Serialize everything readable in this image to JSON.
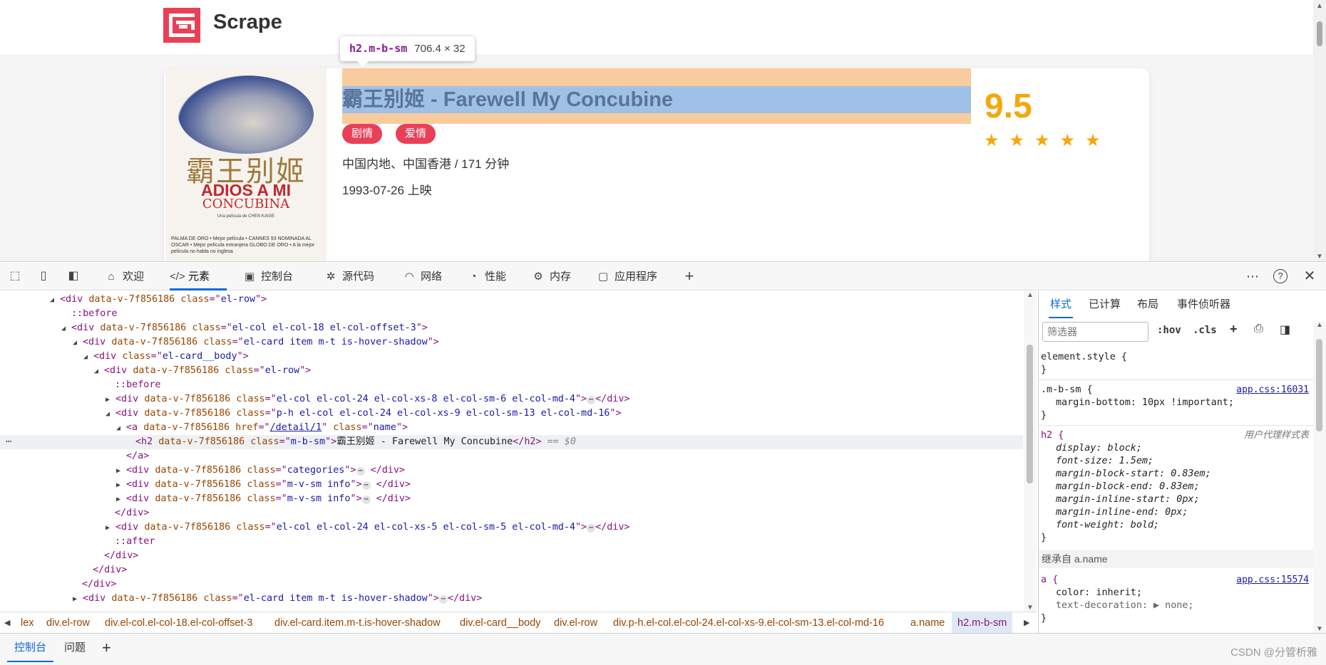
{
  "site": {
    "title": "Scrape"
  },
  "tooltip": {
    "selector": "h2.m-b-sm",
    "size": "706.4 × 32"
  },
  "movie": {
    "poster": {
      "cn_title": "霸王别姬",
      "line1": "ADIOS A MI",
      "line2": "CONCUBINA",
      "credit": "Una película de CHEN KAIGE",
      "bottom": "PALMA DE ORO • Mejor película • CANNES 93 NOMINADA AL OSCAR • Mejor película extranjera GLOBO DE ORO • A la mejor película no habla no inglesa"
    },
    "title": "霸王别姬 - Farewell My Concubine",
    "tags": [
      "剧情",
      "爱情"
    ],
    "region": "中国内地、中国香港 / 171 分钟",
    "release": "1993-07-26 上映",
    "score": "9.5",
    "stars": 5
  },
  "devtools": {
    "tabs": [
      {
        "label": "欢迎",
        "icon": "home-icon"
      },
      {
        "label": "元素",
        "icon": "code-icon"
      },
      {
        "label": "控制台",
        "icon": "console-icon"
      },
      {
        "label": "源代码",
        "icon": "bug-icon"
      },
      {
        "label": "网络",
        "icon": "wifi-icon"
      },
      {
        "label": "性能",
        "icon": "gauge-icon"
      },
      {
        "label": "内存",
        "icon": "chip-icon"
      },
      {
        "label": "应用程序",
        "icon": "app-icon"
      }
    ],
    "dom": {
      "l1": {
        "attr": "data-v-7f856186",
        "cls": "el-row"
      },
      "l2": "::before",
      "l3": {
        "attr": "data-v-7f856186",
        "cls": "el-col el-col-18 el-col-offset-3"
      },
      "l4": {
        "attr": "data-v-7f856186",
        "cls": "el-card item m-t is-hover-shadow"
      },
      "l5": {
        "cls": "el-card__body"
      },
      "l6": {
        "attr": "data-v-7f856186",
        "cls": "el-row"
      },
      "l7": "::before",
      "l8": {
        "attr": "data-v-7f856186",
        "cls": "el-col el-col-24 el-col-xs-8 el-col-sm-6 el-col-md-4"
      },
      "l9": {
        "attr": "data-v-7f856186",
        "cls": "p-h el-col el-col-24 el-col-xs-9 el-col-sm-13 el-col-md-16"
      },
      "l10": {
        "attr": "data-v-7f856186",
        "href": "/detail/1",
        "cls": "name"
      },
      "l11": {
        "attr": "data-v-7f856186",
        "cls": "m-b-sm",
        "text": "霸王别姬 - Farewell My Concubine",
        "ref": "== $0"
      },
      "l13": {
        "attr": "data-v-7f856186",
        "cls": "categories"
      },
      "l14": {
        "attr": "data-v-7f856186",
        "cls": "m-v-sm info"
      },
      "l15": {
        "attr": "data-v-7f856186",
        "cls": "m-v-sm info"
      },
      "l17": {
        "attr": "data-v-7f856186",
        "cls": "el-col el-col-24 el-col-xs-5 el-col-sm-5 el-col-md-4"
      },
      "l18": "::after",
      "l21": {
        "attr": "data-v-7f856186",
        "cls": "el-card item m-t is-hover-shadow"
      }
    },
    "breadcrumbs": [
      "lex",
      "div.el-row",
      "div.el-col.el-col-18.el-col-offset-3",
      "div.el-card.item.m-t.is-hover-shadow",
      "div.el-card__body",
      "div.el-row",
      "div.p-h.el-col.el-col-24.el-col-xs-9.el-col-sm-13.el-col-md-16",
      "a.name",
      "h2.m-b-sm"
    ],
    "styles": {
      "tabs": [
        "样式",
        "已计算",
        "布局",
        "事件侦听器"
      ],
      "filter_placeholder": "筛选器",
      "hov": ":hov",
      "cls": ".cls",
      "element_style": "element.style {",
      "close": "}",
      "rule1": {
        "selector": ".m-b-sm {",
        "source": "app.css:16031",
        "decl": "margin-bottom: 10px !important;"
      },
      "rule2": {
        "selector": "h2 {",
        "source": "用户代理样式表",
        "decls": [
          "display: block;",
          "font-size: 1.5em;",
          "margin-block-start: 0.83em;",
          "margin-block-end: 0.83em;",
          "margin-inline-start: 0px;",
          "margin-inline-end: 0px;",
          "font-weight: bold;"
        ]
      },
      "inherited": "继承自 a.name",
      "rule3": {
        "selector": "a {",
        "source": "app.css:15574",
        "decls": [
          "color: inherit;",
          "text-decoration: ▶ none;"
        ]
      }
    },
    "drawer_tabs": [
      "控制台",
      "问题"
    ],
    "watermark": "CSDN @分管析雅"
  }
}
